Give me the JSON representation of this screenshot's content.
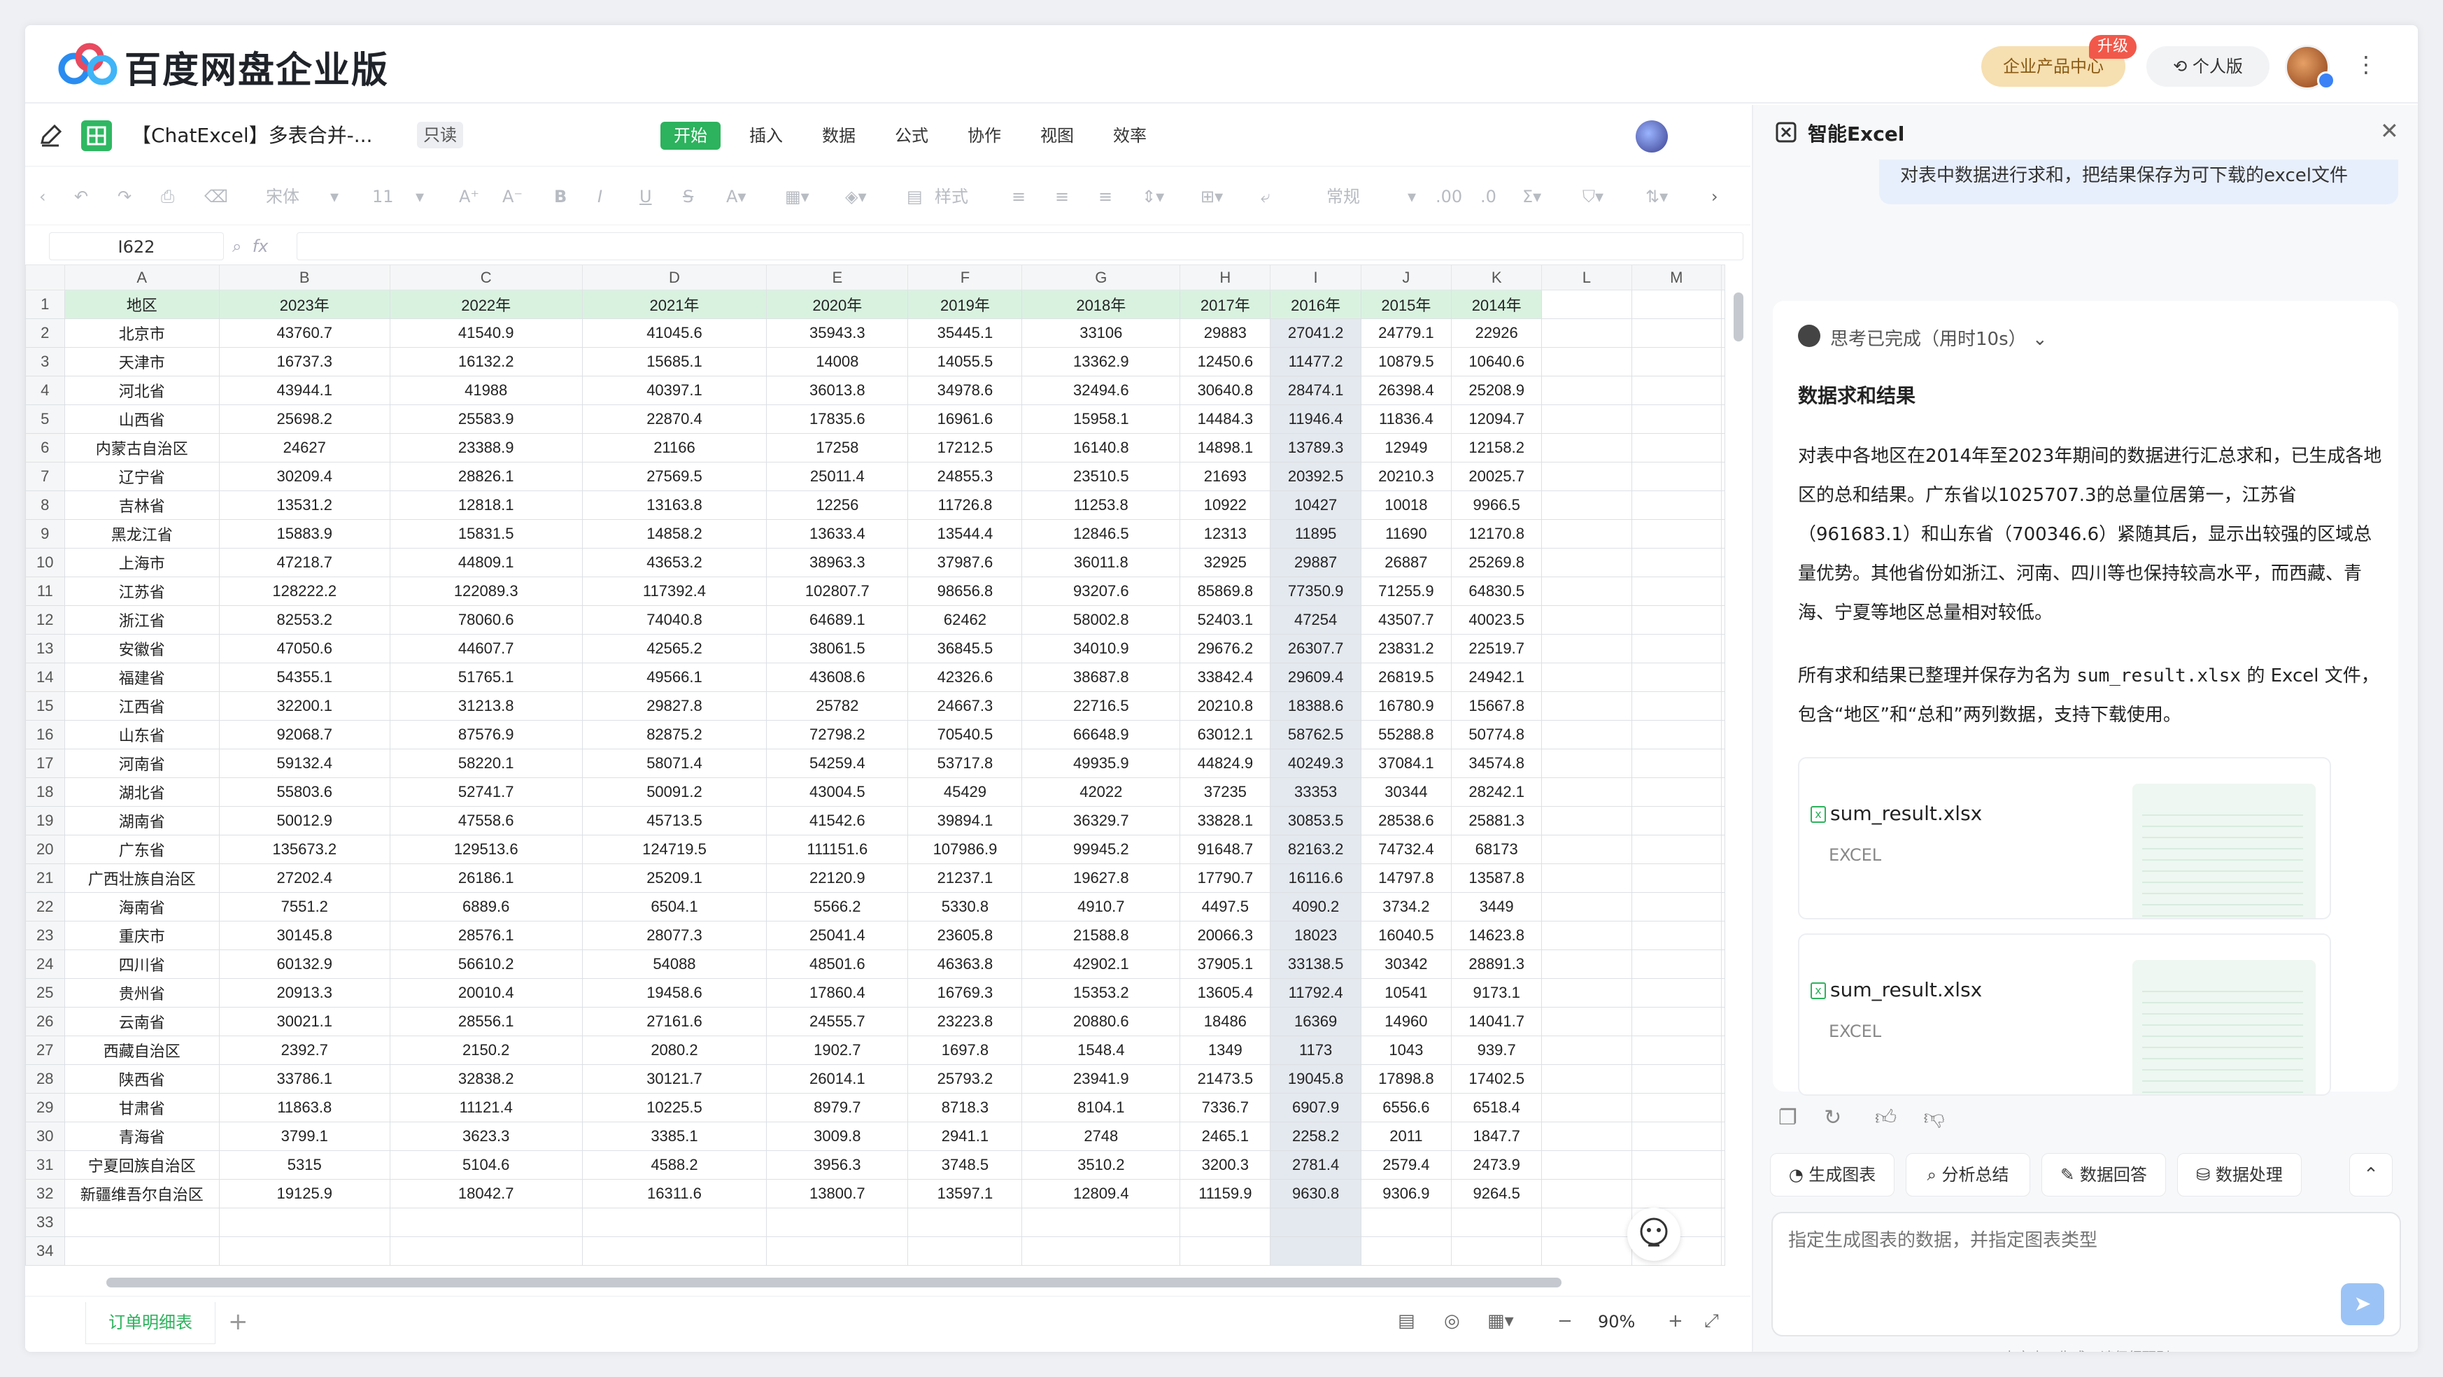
{
  "header": {
    "brand": "百度网盘企业版",
    "enterprise_center": "企业产品中心",
    "upgrade_badge": "升级",
    "personal": "个人版",
    "more_icon": "⋮"
  },
  "doc": {
    "title": "【ChatExcel】多表合并-...",
    "readonly": "只读",
    "tabs": [
      "开始",
      "插入",
      "数据",
      "公式",
      "协作",
      "视图",
      "效率"
    ],
    "active_tab": "开始"
  },
  "toolbar": {
    "font": "宋体",
    "font_size": "11",
    "style_label": "样式",
    "number_format": "常规"
  },
  "formula_bar": {
    "cell_ref": "I622",
    "fx": "fx"
  },
  "sheet": {
    "columns": [
      "A",
      "B",
      "C",
      "D",
      "E",
      "F",
      "G",
      "H",
      "I",
      "J",
      "K",
      "L",
      "M"
    ],
    "header": [
      "地区",
      "2023年",
      "2022年",
      "2021年",
      "2020年",
      "2019年",
      "2018年",
      "2017年",
      "2016年",
      "2015年",
      "2014年"
    ],
    "rows": [
      [
        "北京市",
        "43760.7",
        "41540.9",
        "41045.6",
        "35943.3",
        "35445.1",
        "33106",
        "29883",
        "27041.2",
        "24779.1",
        "22926"
      ],
      [
        "天津市",
        "16737.3",
        "16132.2",
        "15685.1",
        "14008",
        "14055.5",
        "13362.9",
        "12450.6",
        "11477.2",
        "10879.5",
        "10640.6"
      ],
      [
        "河北省",
        "43944.1",
        "41988",
        "40397.1",
        "36013.8",
        "34978.6",
        "32494.6",
        "30640.8",
        "28474.1",
        "26398.4",
        "25208.9"
      ],
      [
        "山西省",
        "25698.2",
        "25583.9",
        "22870.4",
        "17835.6",
        "16961.6",
        "15958.1",
        "14484.3",
        "11946.4",
        "11836.4",
        "12094.7"
      ],
      [
        "内蒙古自治区",
        "24627",
        "23388.9",
        "21166",
        "17258",
        "17212.5",
        "16140.8",
        "14898.1",
        "13789.3",
        "12949",
        "12158.2"
      ],
      [
        "辽宁省",
        "30209.4",
        "28826.1",
        "27569.5",
        "25011.4",
        "24855.3",
        "23510.5",
        "21693",
        "20392.5",
        "20210.3",
        "20025.7"
      ],
      [
        "吉林省",
        "13531.2",
        "12818.1",
        "13163.8",
        "12256",
        "11726.8",
        "11253.8",
        "10922",
        "10427",
        "10018",
        "9966.5"
      ],
      [
        "黑龙江省",
        "15883.9",
        "15831.5",
        "14858.2",
        "13633.4",
        "13544.4",
        "12846.5",
        "12313",
        "11895",
        "11690",
        "12170.8"
      ],
      [
        "上海市",
        "47218.7",
        "44809.1",
        "43653.2",
        "38963.3",
        "37987.6",
        "36011.8",
        "32925",
        "29887",
        "26887",
        "25269.8"
      ],
      [
        "江苏省",
        "128222.2",
        "122089.3",
        "117392.4",
        "102807.7",
        "98656.8",
        "93207.6",
        "85869.8",
        "77350.9",
        "71255.9",
        "64830.5"
      ],
      [
        "浙江省",
        "82553.2",
        "78060.6",
        "74040.8",
        "64689.1",
        "62462",
        "58002.8",
        "52403.1",
        "47254",
        "43507.7",
        "40023.5"
      ],
      [
        "安徽省",
        "47050.6",
        "44607.7",
        "42565.2",
        "38061.5",
        "36845.5",
        "34010.9",
        "29676.2",
        "26307.7",
        "23831.2",
        "22519.7"
      ],
      [
        "福建省",
        "54355.1",
        "51765.1",
        "49566.1",
        "43608.6",
        "42326.6",
        "38687.8",
        "33842.4",
        "29609.4",
        "26819.5",
        "24942.1"
      ],
      [
        "江西省",
        "32200.1",
        "31213.8",
        "29827.8",
        "25782",
        "24667.3",
        "22716.5",
        "20210.8",
        "18388.6",
        "16780.9",
        "15667.8"
      ],
      [
        "山东省",
        "92068.7",
        "87576.9",
        "82875.2",
        "72798.2",
        "70540.5",
        "66648.9",
        "63012.1",
        "58762.5",
        "55288.8",
        "50774.8"
      ],
      [
        "河南省",
        "59132.4",
        "58220.1",
        "58071.4",
        "54259.4",
        "53717.8",
        "49935.9",
        "44824.9",
        "40249.3",
        "37084.1",
        "34574.8"
      ],
      [
        "湖北省",
        "55803.6",
        "52741.7",
        "50091.2",
        "43004.5",
        "45429",
        "42022",
        "37235",
        "33353",
        "30344",
        "28242.1"
      ],
      [
        "湖南省",
        "50012.9",
        "47558.6",
        "45713.5",
        "41542.6",
        "39894.1",
        "36329.7",
        "33828.1",
        "30853.5",
        "28538.6",
        "25881.3"
      ],
      [
        "广东省",
        "135673.2",
        "129513.6",
        "124719.5",
        "111151.6",
        "107986.9",
        "99945.2",
        "91648.7",
        "82163.2",
        "74732.4",
        "68173"
      ],
      [
        "广西壮族自治区",
        "27202.4",
        "26186.1",
        "25209.1",
        "22120.9",
        "21237.1",
        "19627.8",
        "17790.7",
        "16116.6",
        "14797.8",
        "13587.8"
      ],
      [
        "海南省",
        "7551.2",
        "6889.6",
        "6504.1",
        "5566.2",
        "5330.8",
        "4910.7",
        "4497.5",
        "4090.2",
        "3734.2",
        "3449"
      ],
      [
        "重庆市",
        "30145.8",
        "28576.1",
        "28077.3",
        "25041.4",
        "23605.8",
        "21588.8",
        "20066.3",
        "18023",
        "16040.5",
        "14623.8"
      ],
      [
        "四川省",
        "60132.9",
        "56610.2",
        "54088",
        "48501.6",
        "46363.8",
        "42902.1",
        "37905.1",
        "33138.5",
        "30342",
        "28891.3"
      ],
      [
        "贵州省",
        "20913.3",
        "20010.4",
        "19458.6",
        "17860.4",
        "16769.3",
        "15353.2",
        "13605.4",
        "11792.4",
        "10541",
        "9173.1"
      ],
      [
        "云南省",
        "30021.1",
        "28556.1",
        "27161.6",
        "24555.7",
        "23223.8",
        "20880.6",
        "18486",
        "16369",
        "14960",
        "14041.7"
      ],
      [
        "西藏自治区",
        "2392.7",
        "2150.2",
        "2080.2",
        "1902.7",
        "1697.8",
        "1548.4",
        "1349",
        "1173",
        "1043",
        "939.7"
      ],
      [
        "陕西省",
        "33786.1",
        "32838.2",
        "30121.7",
        "26014.1",
        "25793.2",
        "23941.9",
        "21473.5",
        "19045.8",
        "17898.8",
        "17402.5"
      ],
      [
        "甘肃省",
        "11863.8",
        "11121.4",
        "10225.5",
        "8979.7",
        "8718.3",
        "8104.1",
        "7336.7",
        "6907.9",
        "6556.6",
        "6518.4"
      ],
      [
        "青海省",
        "3799.1",
        "3623.3",
        "3385.1",
        "3009.8",
        "2941.1",
        "2748",
        "2465.1",
        "2258.2",
        "2011",
        "1847.7"
      ],
      [
        "宁夏回族自治区",
        "5315",
        "5104.6",
        "4588.2",
        "3956.3",
        "3748.5",
        "3510.2",
        "3200.3",
        "2781.4",
        "2579.4",
        "2473.9"
      ],
      [
        "新疆维吾尔自治区",
        "19125.9",
        "18042.7",
        "16311.6",
        "13800.7",
        "13597.1",
        "12809.4",
        "11159.9",
        "9630.8",
        "9306.9",
        "9264.5"
      ]
    ],
    "extra_row_numbers": [
      "33",
      "34"
    ],
    "selected_column": "I"
  },
  "bottom_bar": {
    "sheet_tab": "订单明细表",
    "add": "+",
    "zoom": "90%"
  },
  "assistant": {
    "title": "智能Excel",
    "user_message": "对表中数据进行求和，把结果保存为可下载的excel文件",
    "thinking": "思考已完成（用时10s）",
    "heading": "数据求和结果",
    "paragraph1": "对表中各地区在2014年至2023年期间的数据进行汇总求和，已生成各地区的总和结果。广东省以1025707.3的总量位居第一，江苏省（961683.1）和山东省（700346.6）紧随其后，显示出较强的区域总量优势。其他省份如浙江、河南、四川等也保持较高水平，而西藏、青海、宁夏等地区总量相对较低。",
    "paragraph2_prefix": "所有求和结果已整理并保存为名为",
    "paragraph2_file": "sum_result.xlsx",
    "paragraph2_suffix": "的 Excel 文件，包含“地区”和“总和”两列数据，支持下载使用。",
    "files": [
      {
        "name": "sum_result.xlsx",
        "type": "EXCEL"
      },
      {
        "name": "sum_result.xlsx",
        "type": "EXCEL"
      }
    ],
    "chips": [
      "生成图表",
      "分析总结",
      "数据回答",
      "数据处理"
    ],
    "input_placeholder": "指定生成图表的数据，并指定图表类型",
    "disclaimer": "内容由AI生成，请仔细甄别"
  },
  "colors": {
    "accent_green": "#2db25d",
    "header_fill": "#d9f2e0",
    "send_blue": "#9cc3f5"
  }
}
